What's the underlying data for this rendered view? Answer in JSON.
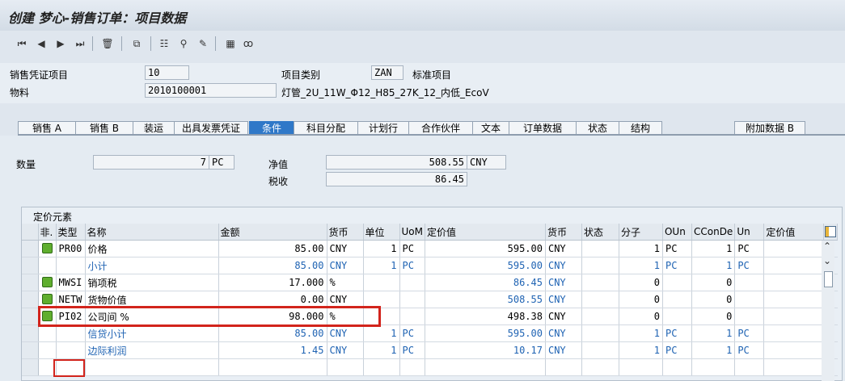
{
  "window": {
    "title": "创建 梦心-销售订单：项目数据"
  },
  "toolbar": {
    "icons": [
      "first-page-icon",
      "prev-page-icon",
      "next-page-icon",
      "last-page-icon",
      "delete-icon",
      "copy-icon",
      "item-details-icon",
      "find-icon",
      "edit-icon",
      "calculator-icon",
      "display-icon"
    ]
  },
  "header": {
    "doc_item_label": "销售凭证项目",
    "doc_item_value": "10",
    "item_cat_label": "项目类别",
    "item_cat_value": "ZAN",
    "item_cat_desc": "标准项目",
    "material_label": "物料",
    "material_value": "2010100001",
    "material_desc": "灯管_2U_11W_Φ12_H85_27K_12_内低_EcoV"
  },
  "tabs": [
    "销售 A",
    "销售 B",
    "装运",
    "出具发票凭证",
    "条件",
    "科目分配",
    "计划行",
    "合作伙伴",
    "文本",
    "订单数据",
    "状态",
    "结构",
    "附加数据 B"
  ],
  "active_tab": "条件",
  "summary": {
    "qty_label": "数量",
    "qty_value": "7",
    "qty_unit": "PC",
    "net_label": "净值",
    "net_value": "508.55",
    "net_currency": "CNY",
    "tax_label": "税收",
    "tax_value": "86.45"
  },
  "pricing": {
    "title": "定价元素",
    "columns": [
      "非.",
      "类型",
      "名称",
      "金额",
      "货币",
      "单位",
      "UoM",
      "定价值",
      "货币",
      "状态",
      "分子",
      "OUn",
      "CConDe",
      "Un",
      "定价值"
    ],
    "rows": [
      {
        "led": true,
        "type": "PR00",
        "name": "价格",
        "amount": "85.00",
        "cur": "CNY",
        "per": "1",
        "uom": "PC",
        "cvalue": "595.00",
        "cur2": "CNY",
        "num": "1",
        "oun": "PC",
        "ccon": "1",
        "un": "PC",
        "blue": false
      },
      {
        "led": false,
        "type": "",
        "name": "小计",
        "amount": "85.00",
        "cur": "CNY",
        "per": "1",
        "uom": "PC",
        "cvalue": "595.00",
        "cur2": "CNY",
        "num": "1",
        "oun": "PC",
        "ccon": "1",
        "un": "PC",
        "blue": true
      },
      {
        "led": true,
        "type": "MWSI",
        "name": "销项税",
        "amount": "17.000",
        "cur": "%",
        "per": "",
        "uom": "",
        "cvalue": "86.45",
        "cur2": "CNY",
        "num": "0",
        "oun": "",
        "ccon": "0",
        "un": "",
        "blue": false,
        "cblue": true
      },
      {
        "led": true,
        "type": "NETW",
        "name": "货物价值",
        "amount": "0.00",
        "cur": "CNY",
        "per": "",
        "uom": "",
        "cvalue": "508.55",
        "cur2": "CNY",
        "num": "0",
        "oun": "",
        "ccon": "0",
        "un": "",
        "blue": false,
        "cblue": true
      },
      {
        "led": true,
        "type": "PI02",
        "name": "公司间 %",
        "amount": "98.000",
        "cur": "%",
        "per": "",
        "uom": "",
        "cvalue": "498.38",
        "cur2": "CNY",
        "num": "0",
        "oun": "",
        "ccon": "0",
        "un": "",
        "blue": false
      },
      {
        "led": false,
        "type": "",
        "name": "信贷小计",
        "amount": "85.00",
        "cur": "CNY",
        "per": "1",
        "uom": "PC",
        "cvalue": "595.00",
        "cur2": "CNY",
        "num": "1",
        "oun": "PC",
        "ccon": "1",
        "un": "PC",
        "blue": true
      },
      {
        "led": false,
        "type": "",
        "name": "边际利润",
        "amount": "1.45",
        "cur": "CNY",
        "per": "1",
        "uom": "PC",
        "cvalue": "10.17",
        "cur2": "CNY",
        "num": "1",
        "oun": "PC",
        "ccon": "1",
        "un": "PC",
        "blue": true
      }
    ]
  },
  "colors": {
    "highlight": "#d2241c",
    "active_tab": "#2f78c8",
    "row_link": "#1f63b3"
  }
}
